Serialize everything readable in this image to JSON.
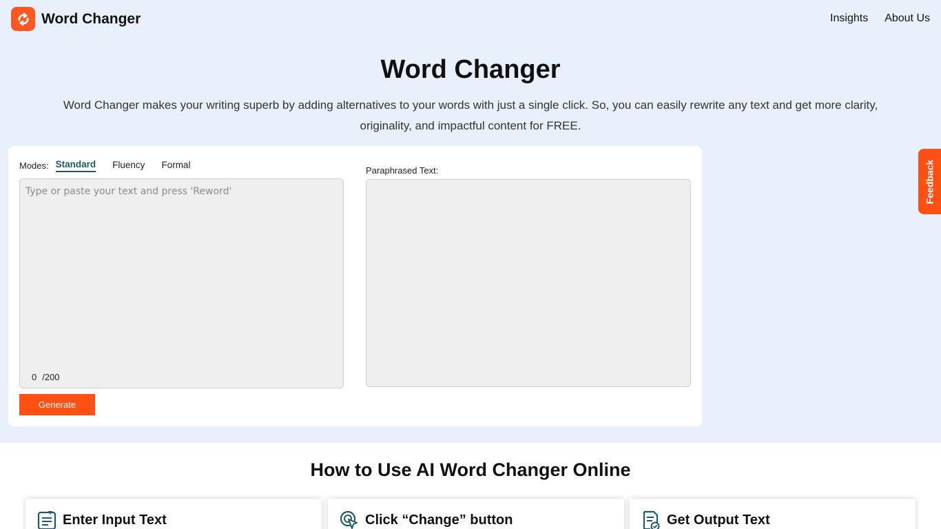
{
  "brand": {
    "name": "Word Changer",
    "icon": "refresh-arrows-icon",
    "color": "#ff5722"
  },
  "nav": {
    "items": [
      "Insights",
      "About Us"
    ]
  },
  "hero": {
    "title": "Word Changer",
    "subtitle": "Word Changer makes your writing superb by adding alternatives to your words with just a single click. So, you can easily rewrite any text and get more clarity, originality, and impactful content for FREE."
  },
  "tool": {
    "modes_label": "Modes:",
    "modes": [
      "Standard",
      "Fluency",
      "Formal"
    ],
    "active_mode": "Standard",
    "input_placeholder": "Type or paste your text and press 'Reword'",
    "input_value": "",
    "count": "0",
    "limit": "/200",
    "generate_label": "Generate",
    "output_label": "Paraphrased Text:"
  },
  "feedback_label": "Feedback",
  "how_to": {
    "title": "How to Use AI Word Changer Online",
    "steps": [
      {
        "title": "Enter Input Text",
        "icon": "document-edit-icon"
      },
      {
        "title": "Click “Change” button",
        "icon": "click-cursor-icon"
      },
      {
        "title": "Get Output Text",
        "icon": "document-check-icon"
      }
    ]
  },
  "colors": {
    "accent": "#ff5014",
    "hero_bg": "#e8f1fb",
    "active_tab": "#1d5a63"
  }
}
